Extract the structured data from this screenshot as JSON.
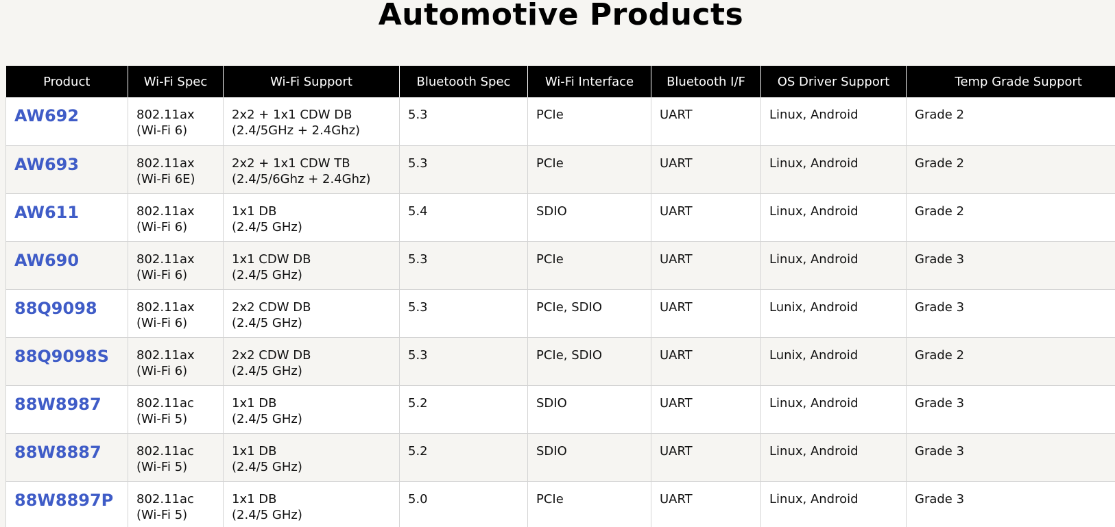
{
  "page": {
    "title": "Automotive Products"
  },
  "table": {
    "headers": [
      "Product",
      "Wi-Fi Spec",
      "Wi-Fi Support",
      "Bluetooth Spec",
      "Wi-Fi Interface",
      "Bluetooth I/F",
      "OS Driver Support",
      "Temp Grade Support"
    ],
    "rows": [
      {
        "product": "AW692",
        "wifi_spec_1": "802.11ax",
        "wifi_spec_2": "(Wi-Fi 6)",
        "wifi_support_1": "2x2 + 1x1 CDW DB",
        "wifi_support_2": "(2.4/5GHz + 2.4Ghz)",
        "bt_spec": "5.3",
        "wifi_if": "PCIe",
        "bt_if": "UART",
        "os": "Linux, Android",
        "temp": "Grade 2"
      },
      {
        "product": "AW693",
        "wifi_spec_1": "802.11ax",
        "wifi_spec_2": "(Wi-Fi 6E)",
        "wifi_support_1": "2x2 + 1x1 CDW TB",
        "wifi_support_2": "(2.4/5/6Ghz + 2.4Ghz)",
        "bt_spec": "5.3",
        "wifi_if": "PCIe",
        "bt_if": "UART",
        "os": "Linux, Android",
        "temp": "Grade 2"
      },
      {
        "product": "AW611",
        "wifi_spec_1": "802.11ax",
        "wifi_spec_2": "(Wi-Fi 6)",
        "wifi_support_1": "1x1 DB",
        "wifi_support_2": "(2.4/5 GHz)",
        "bt_spec": "5.4",
        "wifi_if": "SDIO",
        "bt_if": "UART",
        "os": "Linux, Android",
        "temp": "Grade 2"
      },
      {
        "product": "AW690",
        "wifi_spec_1": "802.11ax",
        "wifi_spec_2": "(Wi-Fi 6)",
        "wifi_support_1": "1x1 CDW DB",
        "wifi_support_2": "(2.4/5 GHz)",
        "bt_spec": "5.3",
        "wifi_if": "PCIe",
        "bt_if": "UART",
        "os": "Linux, Android",
        "temp": "Grade 3"
      },
      {
        "product": "88Q9098",
        "wifi_spec_1": "802.11ax",
        "wifi_spec_2": "(Wi-Fi 6)",
        "wifi_support_1": "2x2 CDW DB",
        "wifi_support_2": "(2.4/5 GHz)",
        "bt_spec": "5.3",
        "wifi_if": "PCIe, SDIO",
        "bt_if": "UART",
        "os": "Lunix, Android",
        "temp": "Grade 3"
      },
      {
        "product": "88Q9098S",
        "wifi_spec_1": "802.11ax",
        "wifi_spec_2": "(Wi-Fi 6)",
        "wifi_support_1": "2x2 CDW DB",
        "wifi_support_2": "(2.4/5 GHz)",
        "bt_spec": "5.3",
        "wifi_if": "PCIe, SDIO",
        "bt_if": "UART",
        "os": "Lunix, Android",
        "temp": "Grade 2"
      },
      {
        "product": "88W8987",
        "wifi_spec_1": "802.11ac",
        "wifi_spec_2": "(Wi-Fi 5)",
        "wifi_support_1": "1x1 DB",
        "wifi_support_2": "(2.4/5 GHz)",
        "bt_spec": "5.2",
        "wifi_if": "SDIO",
        "bt_if": "UART",
        "os": "Linux, Android",
        "temp": "Grade 3"
      },
      {
        "product": "88W8887",
        "wifi_spec_1": "802.11ac",
        "wifi_spec_2": "(Wi-Fi 5)",
        "wifi_support_1": "1x1 DB",
        "wifi_support_2": "(2.4/5 GHz)",
        "bt_spec": "5.2",
        "wifi_if": "SDIO",
        "bt_if": "UART",
        "os": "Linux, Android",
        "temp": "Grade 3"
      },
      {
        "product": "88W8897P",
        "wifi_spec_1": "802.11ac",
        "wifi_spec_2": "(Wi-Fi 5)",
        "wifi_support_1": "1x1 DB",
        "wifi_support_2": "(2.4/5 GHz)",
        "bt_spec": "5.0",
        "wifi_if": "PCIe",
        "bt_if": "UART",
        "os": "Linux, Android",
        "temp": "Grade 3"
      }
    ]
  },
  "colors": {
    "header_bg": "#000000",
    "link": "#3f5cc7",
    "row_alt": "#f6f5f2"
  }
}
